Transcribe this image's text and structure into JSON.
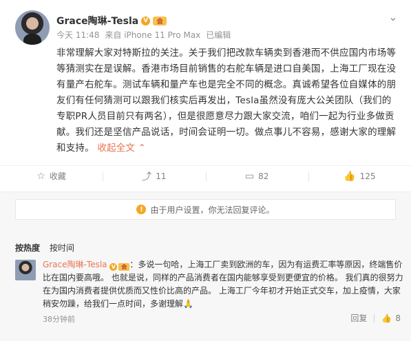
{
  "post": {
    "author": "Grace陶琳-Tesla",
    "v_badge": "V",
    "vip_badge": "会",
    "time": "今天 11:48",
    "source": "来自 iPhone 11 Pro Max",
    "edited": "已编辑",
    "more_icon": "chevron-down-icon",
    "text": "非常理解大家对特斯拉的关注。关于我们把改款车辆卖到香港而不供应国内市场等等猜测实在是误解。香港市场目前销售的右舵车辆是进口自美国，上海工厂现在没有量产右舵车。测试车辆和量产车也是完全不同的概念。真诚希望各位自媒体的朋友们有任何猜测可以跟我们核实后再发出，Tesla虽然没有庞大公关团队（我们的专职PR人员目前只有两名），但是很愿意尽力跟大家交流，咱们一起为行业多做贡献。我们还是坚信产品说话，时间会证明一切。做点事儿不容易，感谢大家的理解和支持。",
    "collapse": "收起全文",
    "collapse_icon": "collapse-icon"
  },
  "actions": {
    "favorite": {
      "label": "收藏",
      "icon": "star-icon"
    },
    "repost": {
      "label": "11",
      "icon": "repost-icon"
    },
    "comment": {
      "label": "82",
      "icon": "comment-icon"
    },
    "like": {
      "label": "125",
      "icon": "thumbs-up-icon"
    }
  },
  "notice": {
    "text": "由于用户设置，你无法回复评论。",
    "icon": "warning-icon"
  },
  "sort": {
    "hot": "按热度",
    "time": "按时间"
  },
  "comment": {
    "author": "Grace陶琳-Tesla",
    "text": "：多说一句哈，上海工厂卖到欧洲的车，因为有运费汇率等原因，终端售价比在国内要高哦。 也就是说，同样的产品消费者在国内能够享受到更便宜的价格。 我们真的很努力在为国内消费者提供优质而又性价比高的产品。 上海工厂今年初才开始正式交车，加上疫情，大家稍安勿躁，给我们一点时间，多谢理解",
    "emoji": "🙏",
    "time": "38分钟前",
    "reply": "回复",
    "likes": "8",
    "like_icon": "thumbs-up-icon"
  }
}
